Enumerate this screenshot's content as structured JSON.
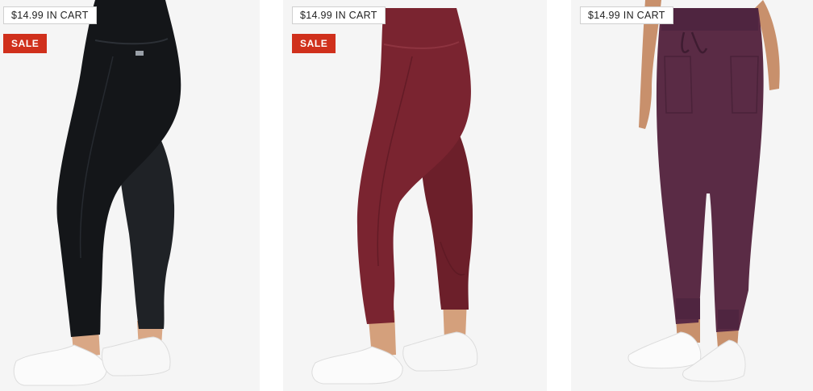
{
  "colors": {
    "sale_badge": "#d0301c",
    "card_background": "#f5f5f5"
  },
  "products": [
    {
      "price_cart_label": "$14.99 IN CART",
      "sale_label": "SALE",
      "legging_color": "#141619"
    },
    {
      "price_cart_label": "$14.99 IN CART",
      "sale_label": "SALE",
      "legging_color": "#7a2430"
    },
    {
      "price_cart_label": "$14.99 IN CART",
      "legging_color": "#5a2b45"
    }
  ]
}
